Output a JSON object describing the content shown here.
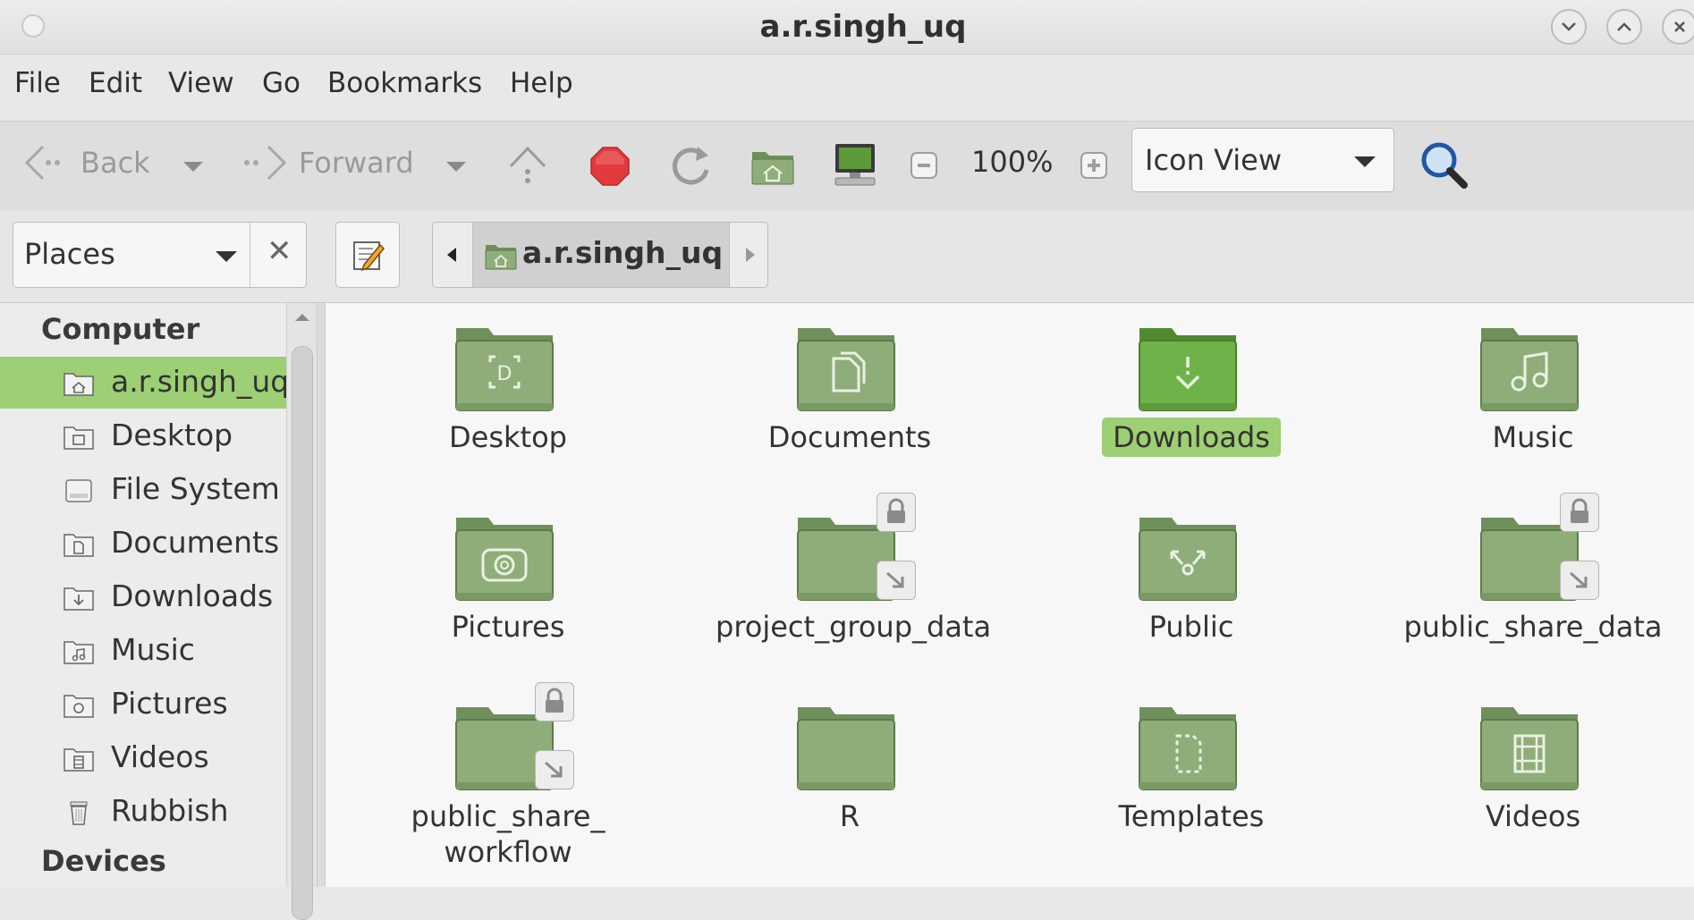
{
  "window": {
    "title": "a.r.singh_uq"
  },
  "menu": [
    "File",
    "Edit",
    "View",
    "Go",
    "Bookmarks",
    "Help"
  ],
  "toolbar": {
    "back_label": "Back",
    "forward_label": "Forward",
    "zoom": "100%",
    "view_mode": "Icon View"
  },
  "location": {
    "places_label": "Places",
    "breadcrumb": "a.r.singh_uq"
  },
  "sidebar": {
    "computer_heading": "Computer",
    "items": [
      {
        "label": "a.r.singh_uq",
        "icon": "home-folder-icon",
        "selected": true
      },
      {
        "label": "Desktop",
        "icon": "desktop-folder-icon"
      },
      {
        "label": "File System",
        "icon": "drive-icon"
      },
      {
        "label": "Documents",
        "icon": "documents-folder-icon"
      },
      {
        "label": "Downloads",
        "icon": "downloads-folder-icon"
      },
      {
        "label": "Music",
        "icon": "music-folder-icon"
      },
      {
        "label": "Pictures",
        "icon": "pictures-folder-icon"
      },
      {
        "label": "Videos",
        "icon": "videos-folder-icon"
      },
      {
        "label": "Rubbish",
        "icon": "trash-icon"
      }
    ],
    "devices_heading": "Devices"
  },
  "files": [
    {
      "name": "Desktop",
      "glyph": "desktop"
    },
    {
      "name": "Documents",
      "glyph": "documents"
    },
    {
      "name": "Downloads",
      "glyph": "downloads",
      "selected": true
    },
    {
      "name": "Music",
      "glyph": "music"
    },
    {
      "name": "Pictures",
      "glyph": "pictures"
    },
    {
      "name": "project_group_data",
      "glyph": "none",
      "locked": true,
      "symlink": true
    },
    {
      "name": "Public",
      "glyph": "public"
    },
    {
      "name": "public_share_data",
      "glyph": "none",
      "locked": true,
      "symlink": true
    },
    {
      "name": "public_share_\nworkflow",
      "glyph": "none",
      "locked": true,
      "symlink": true
    },
    {
      "name": "R",
      "glyph": "none"
    },
    {
      "name": "Templates",
      "glyph": "templates"
    },
    {
      "name": "Videos",
      "glyph": "videos"
    }
  ],
  "colors": {
    "folder": "#8fad78",
    "selection": "#9dcf74",
    "accent_green": "#6fb24a"
  }
}
